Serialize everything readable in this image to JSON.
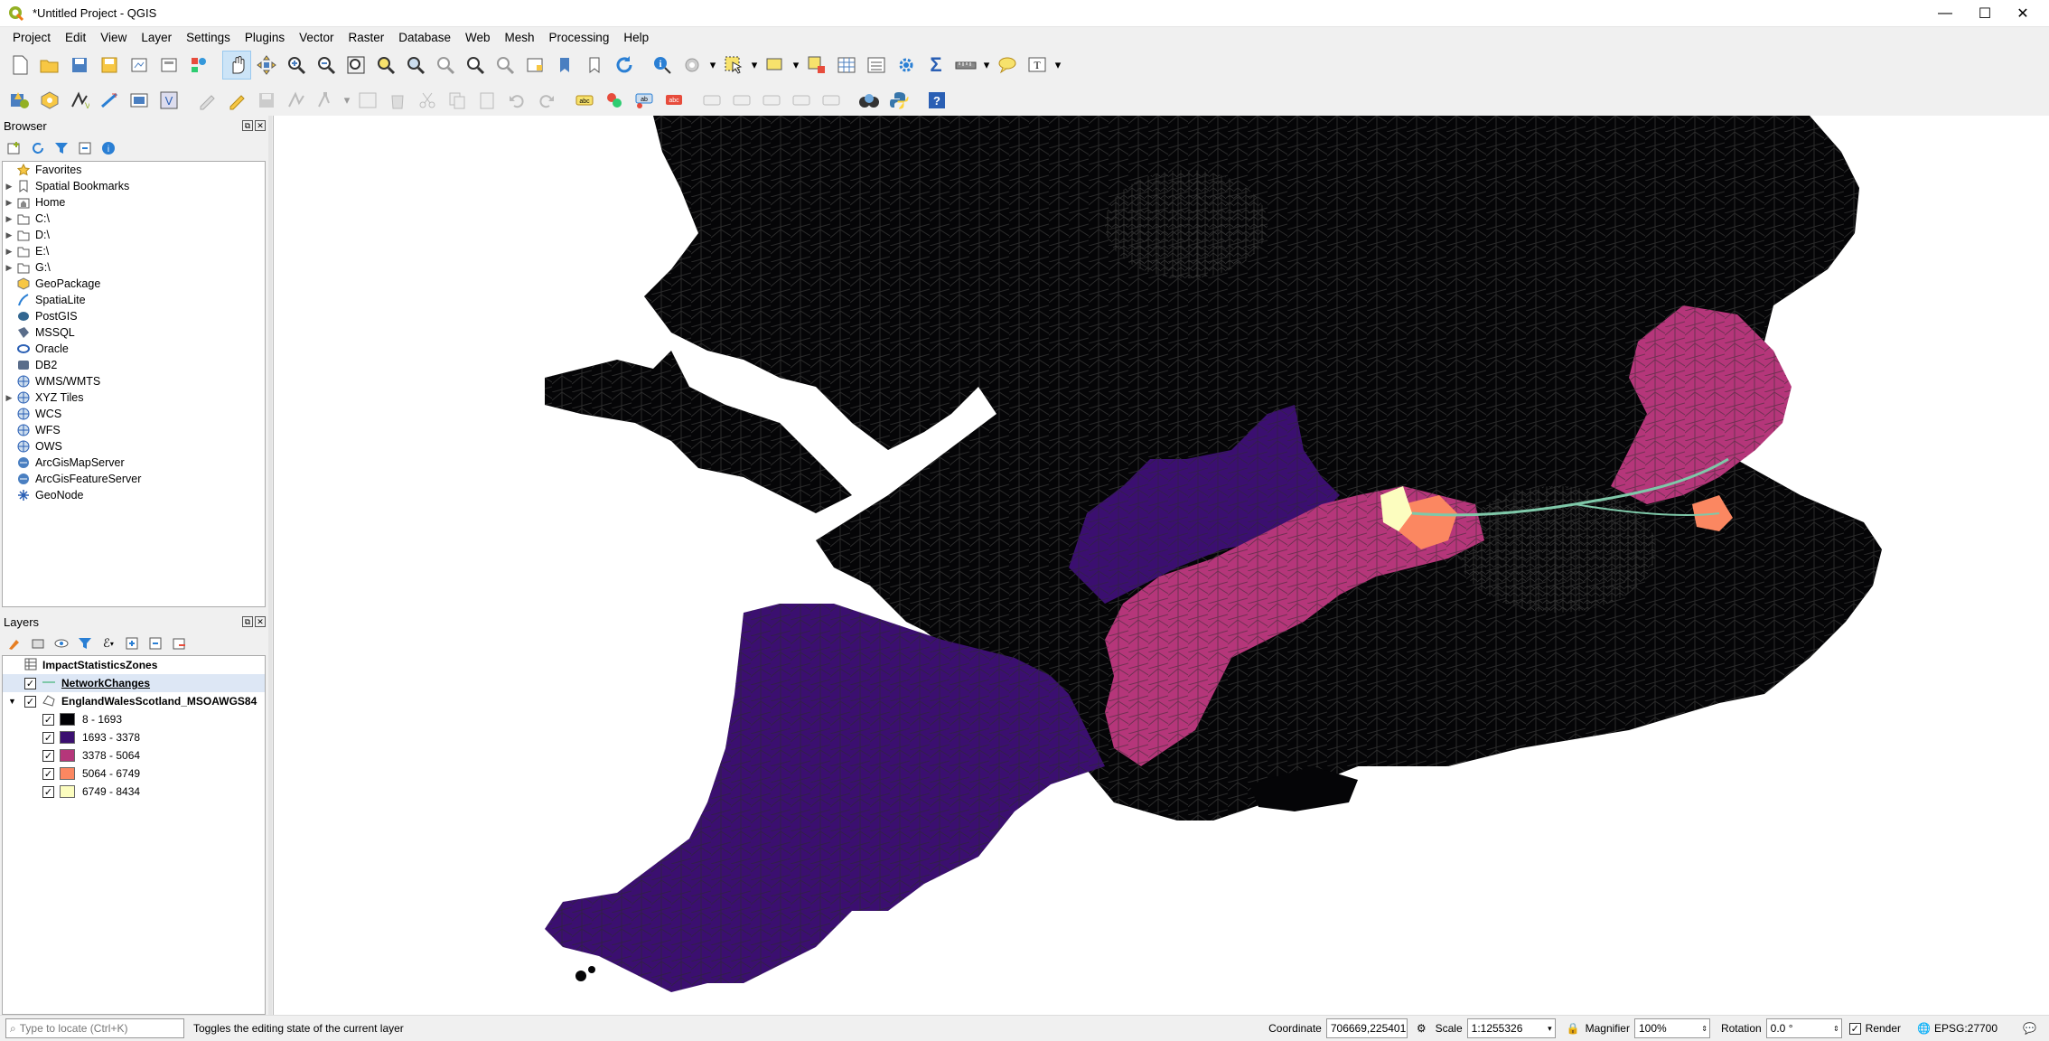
{
  "window": {
    "title": "*Untitled Project - QGIS"
  },
  "menu": [
    "Project",
    "Edit",
    "View",
    "Layer",
    "Settings",
    "Plugins",
    "Vector",
    "Raster",
    "Database",
    "Web",
    "Mesh",
    "Processing",
    "Help"
  ],
  "browser": {
    "title": "Browser",
    "items": [
      {
        "label": "Favorites",
        "icon": "star-icon",
        "expand": false
      },
      {
        "label": "Spatial Bookmarks",
        "icon": "bookmark-icon",
        "expand": true
      },
      {
        "label": "Home",
        "icon": "home-folder-icon",
        "expand": true
      },
      {
        "label": "C:\\",
        "icon": "folder-icon",
        "expand": true
      },
      {
        "label": "D:\\",
        "icon": "folder-icon",
        "expand": true
      },
      {
        "label": "E:\\",
        "icon": "folder-icon",
        "expand": true
      },
      {
        "label": "G:\\",
        "icon": "folder-icon",
        "expand": true
      },
      {
        "label": "GeoPackage",
        "icon": "geopackage-icon",
        "expand": false
      },
      {
        "label": "SpatiaLite",
        "icon": "spatialite-icon",
        "expand": false
      },
      {
        "label": "PostGIS",
        "icon": "postgis-icon",
        "expand": false
      },
      {
        "label": "MSSQL",
        "icon": "mssql-icon",
        "expand": false
      },
      {
        "label": "Oracle",
        "icon": "oracle-icon",
        "expand": false
      },
      {
        "label": "DB2",
        "icon": "db2-icon",
        "expand": false
      },
      {
        "label": "WMS/WMTS",
        "icon": "globe-icon",
        "expand": false
      },
      {
        "label": "XYZ Tiles",
        "icon": "globe-icon",
        "expand": true
      },
      {
        "label": "WCS",
        "icon": "globe-icon",
        "expand": false
      },
      {
        "label": "WFS",
        "icon": "globe-icon",
        "expand": false
      },
      {
        "label": "OWS",
        "icon": "globe-icon",
        "expand": false
      },
      {
        "label": "ArcGisMapServer",
        "icon": "arcgis-icon",
        "expand": false
      },
      {
        "label": "ArcGisFeatureServer",
        "icon": "arcgis-icon",
        "expand": false
      },
      {
        "label": "GeoNode",
        "icon": "geonode-icon",
        "expand": false
      }
    ]
  },
  "layers": {
    "title": "Layers",
    "items": [
      {
        "label": "ImpactStatisticsZones",
        "checked": false,
        "type": "table"
      },
      {
        "label": "NetworkChanges",
        "checked": true,
        "type": "line"
      },
      {
        "label": "EnglandWalesScotland_MSOAWGS84",
        "checked": true,
        "type": "polygon"
      }
    ],
    "legend": [
      {
        "label": "8 - 1693",
        "color": "#000004"
      },
      {
        "label": "1693 - 3378",
        "color": "#3b0f70"
      },
      {
        "label": "3378 - 5064",
        "color": "#b5367a"
      },
      {
        "label": "5064 - 6749",
        "color": "#fb8761"
      },
      {
        "label": "6749 - 8434",
        "color": "#fcfdbf"
      }
    ]
  },
  "status": {
    "locator_placeholder": "Type to locate (Ctrl+K)",
    "message": "Toggles the editing state of the current layer",
    "coordinate_label": "Coordinate",
    "coordinate": "706669,225401",
    "scale_label": "Scale",
    "scale": "1:1255326",
    "magnifier_label": "Magnifier",
    "magnifier": "100%",
    "rotation_label": "Rotation",
    "rotation": "0.0 °",
    "render_label": "Render",
    "crs": "EPSG:27700"
  }
}
